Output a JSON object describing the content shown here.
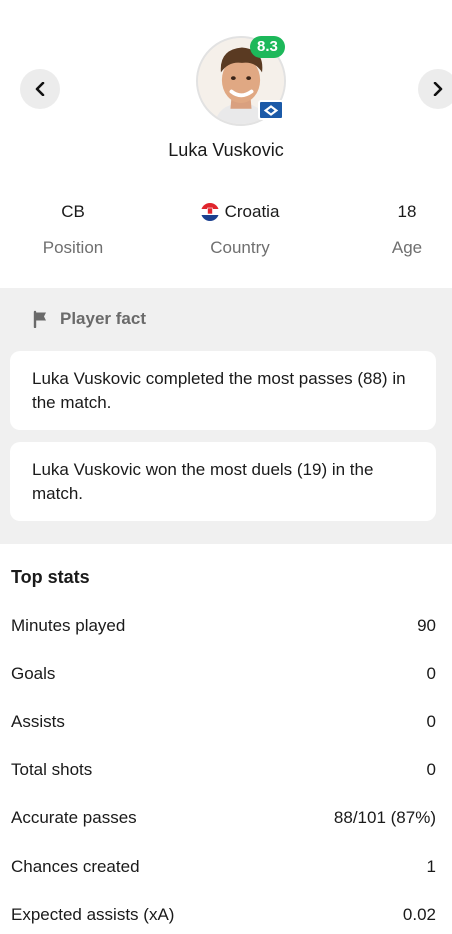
{
  "header": {
    "player_name": "Luka Vuskovic",
    "rating": "8.3",
    "prev_icon": "chevron-left-icon",
    "next_icon": "chevron-right-icon",
    "rating_color": "#1db85a",
    "club_color": "#1b5aa8"
  },
  "info": {
    "position_value": "CB",
    "position_label": "Position",
    "country_value": "Croatia",
    "country_label": "Country",
    "age_value": "18",
    "age_label": "Age"
  },
  "facts": {
    "title": "Player fact",
    "icon": "flag-icon",
    "items": [
      "Luka Vuskovic completed the most passes (88) in the match.",
      "Luka Vuskovic won the most duels (19) in the match."
    ]
  },
  "top_stats": {
    "title": "Top stats",
    "rows": [
      {
        "label": "Minutes played",
        "value": "90"
      },
      {
        "label": "Goals",
        "value": "0"
      },
      {
        "label": "Assists",
        "value": "0"
      },
      {
        "label": "Total shots",
        "value": "0"
      },
      {
        "label": "Accurate passes",
        "value": "88/101 (87%)"
      },
      {
        "label": "Chances created",
        "value": "1"
      },
      {
        "label": "Expected assists (xA)",
        "value": "0.02"
      }
    ]
  }
}
